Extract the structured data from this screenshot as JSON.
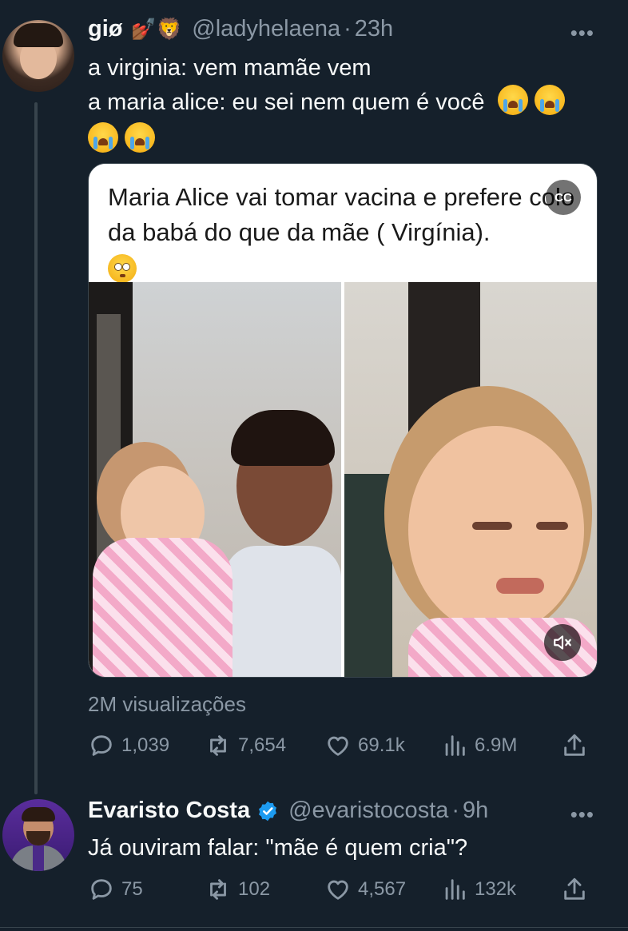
{
  "tweet1": {
    "author_name": "giø",
    "author_emojis": "💅🏾🦁",
    "handle": "@ladyhelaena",
    "separator": "·",
    "time": "23h",
    "more": "•••",
    "text_line1": "a virginia: vem mamãe vem",
    "text_line2": "a maria alice: eu sei nem quem é você",
    "media_caption": "Maria Alice vai tomar  vacina e prefere colo da babá do que da mãe ( Virgínia).",
    "media_cc": "CC",
    "views": "2M visualizações",
    "replies": "1,039",
    "retweets": "7,654",
    "likes": "69.1k",
    "analytics": "6.9M"
  },
  "tweet2": {
    "author_name": "Evaristo Costa",
    "handle": "@evaristocosta",
    "separator": "·",
    "time": "9h",
    "more": "•••",
    "text": "Já ouviram falar: \"mãe é quem cria\"?",
    "replies": "75",
    "retweets": "102",
    "likes": "4,567",
    "analytics": "132k"
  },
  "colors": {
    "background": "#15202b",
    "text": "#f7f9f9",
    "muted": "#8b98a5",
    "verified": "#1d9bf0",
    "border": "#38444d"
  },
  "icons": [
    "reply-icon",
    "retweet-icon",
    "like-icon",
    "analytics-icon",
    "share-icon",
    "verified-icon",
    "mute-icon",
    "cc-icon"
  ]
}
